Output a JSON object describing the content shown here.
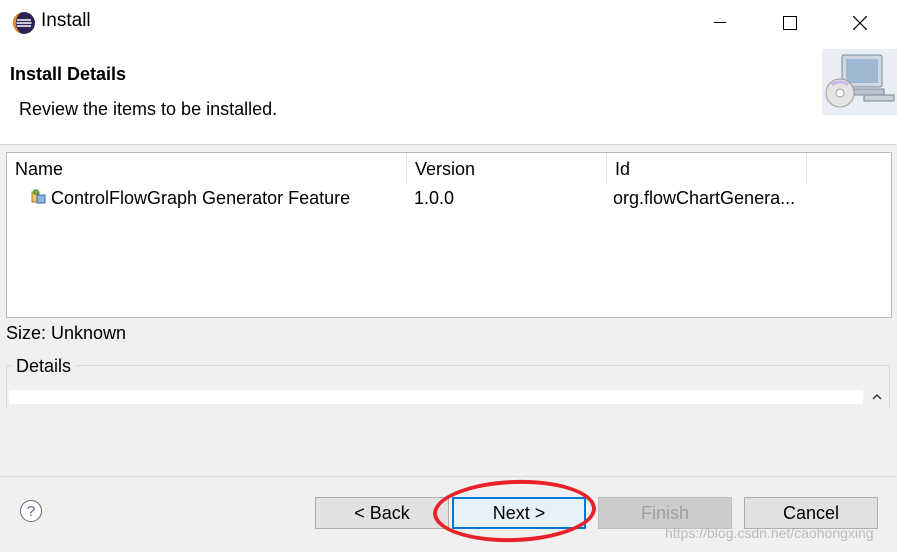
{
  "window": {
    "title": "Install",
    "app_icon": "eclipse-icon",
    "controls": {
      "minimize": "minimize-icon",
      "maximize": "maximize-icon",
      "close": "close-icon"
    }
  },
  "banner": {
    "title": "Install Details",
    "message": "Review the items to be installed.",
    "image": "install-cd-computer-icon"
  },
  "table": {
    "columns": [
      "Name",
      "Version",
      "Id"
    ],
    "rows": [
      {
        "icon": "feature-icon",
        "name": "ControlFlowGraph Generator Feature",
        "version": "1.0.0",
        "id": "org.flowChartGenera..."
      }
    ]
  },
  "size_label": "Size: Unknown",
  "details": {
    "label": "Details",
    "scroll_icon": "chevron-up-icon"
  },
  "buttons": {
    "help": "?",
    "back": "< Back",
    "next": "Next >",
    "finish": "Finish",
    "cancel": "Cancel"
  },
  "annotation": {
    "color": "#e8212a"
  },
  "watermark": "https://blog.csdn.net/caohongxing",
  "colors": {
    "accent": "#0078d7",
    "highlight": "#e8212a"
  }
}
